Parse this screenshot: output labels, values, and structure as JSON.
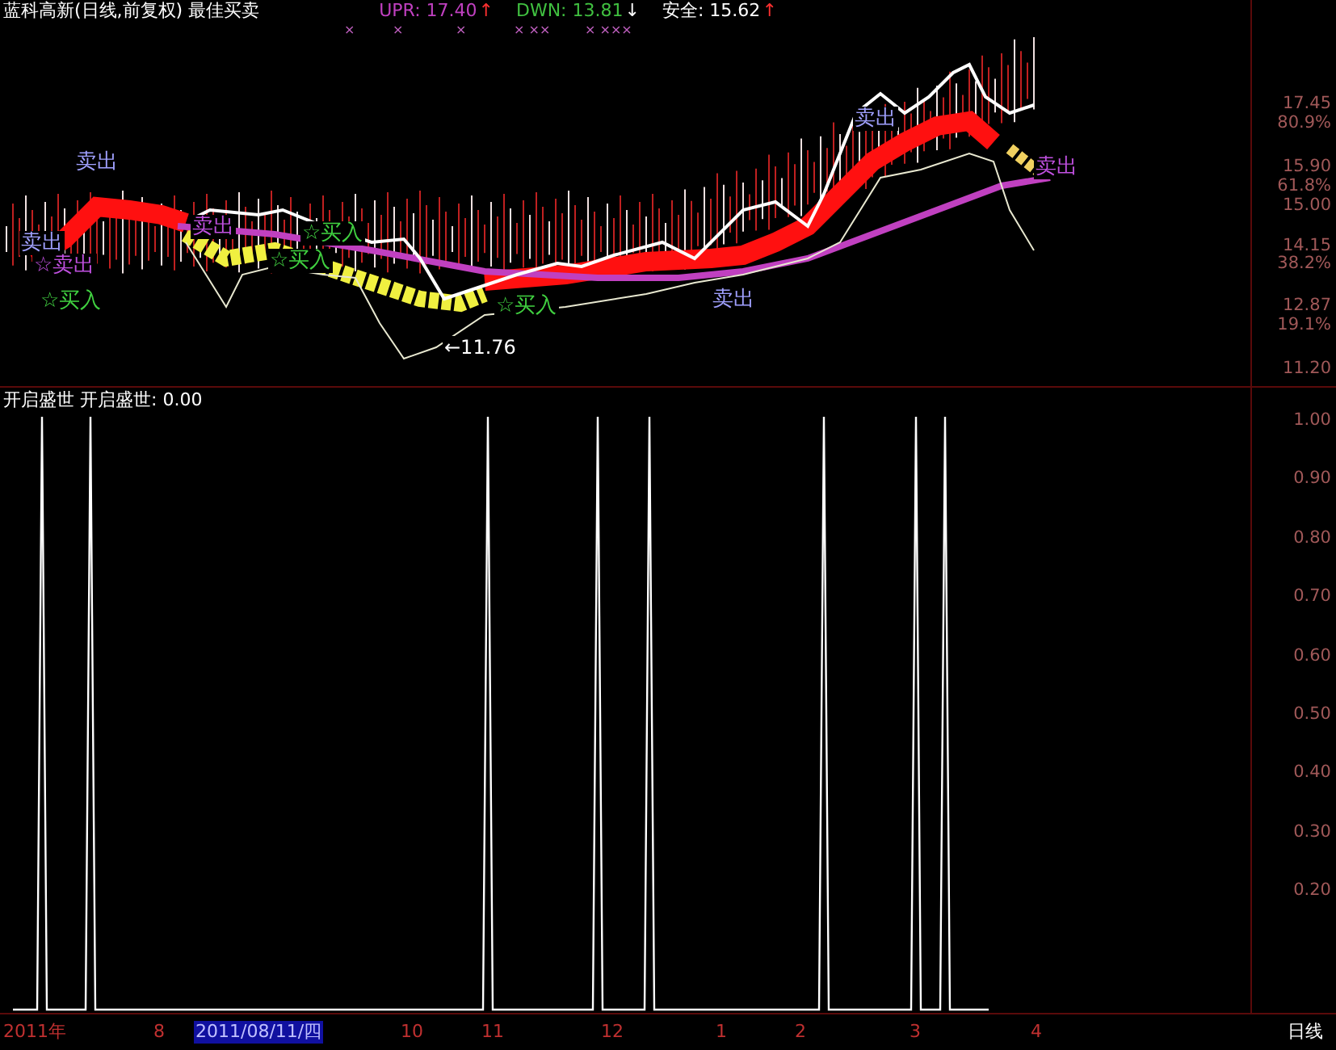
{
  "header": {
    "title": "蓝科高新(日线,前复权) 最佳买卖",
    "indicators": [
      {
        "label": "UPR: 17.40",
        "arrow": "↑",
        "color": "#c040c0",
        "kind": "up"
      },
      {
        "label": "DWN: 13.81",
        "arrow": "↓",
        "color": "#40c040",
        "kind": "down"
      },
      {
        "label": "安全: 15.62",
        "arrow": "↑",
        "color": "#ffffff",
        "kind": "up"
      }
    ],
    "markers": [
      "×",
      "×",
      "×",
      "× ××",
      "× ×××"
    ]
  },
  "price_chart": {
    "signals": [
      {
        "text": "卖出",
        "kind": "sell"
      },
      {
        "text": "卖出",
        "kind": "sell"
      },
      {
        "text": "☆卖出",
        "kind": "sell_alt"
      },
      {
        "text": "☆买入",
        "kind": "buy"
      },
      {
        "text": "卖出",
        "kind": "sell_alt"
      },
      {
        "text": "☆买入",
        "kind": "buy"
      },
      {
        "text": "☆买入",
        "kind": "buy"
      },
      {
        "text": "☆买入",
        "kind": "buy"
      },
      {
        "text": "卖出",
        "kind": "sell"
      },
      {
        "text": "卖出",
        "kind": "sell"
      },
      {
        "text": "卖出",
        "kind": "sell_alt"
      }
    ],
    "low_label": "←11.76",
    "axis_labels": [
      "17.45",
      "80.9%",
      "15.90",
      "61.8%",
      "15.00",
      "14.15",
      "38.2%",
      "12.87",
      "19.1%",
      "11.20"
    ]
  },
  "indicator_panel": {
    "title": "开启盛世 开启盛世: 0.00",
    "axis_labels": [
      "1.00",
      "0.90",
      "0.80",
      "0.70",
      "0.60",
      "0.50",
      "0.40",
      "0.30",
      "0.20"
    ]
  },
  "time_axis": {
    "labels": [
      {
        "text": "2011年",
        "selected": false
      },
      {
        "text": "8",
        "selected": false
      },
      {
        "text": "2011/08/11/四",
        "selected": true
      },
      {
        "text": "10",
        "selected": false
      },
      {
        "text": "11",
        "selected": false
      },
      {
        "text": "12",
        "selected": false
      },
      {
        "text": "1",
        "selected": false
      },
      {
        "text": "2",
        "selected": false
      },
      {
        "text": "3",
        "selected": false
      },
      {
        "text": "4",
        "selected": false
      }
    ],
    "period": "日线"
  }
}
